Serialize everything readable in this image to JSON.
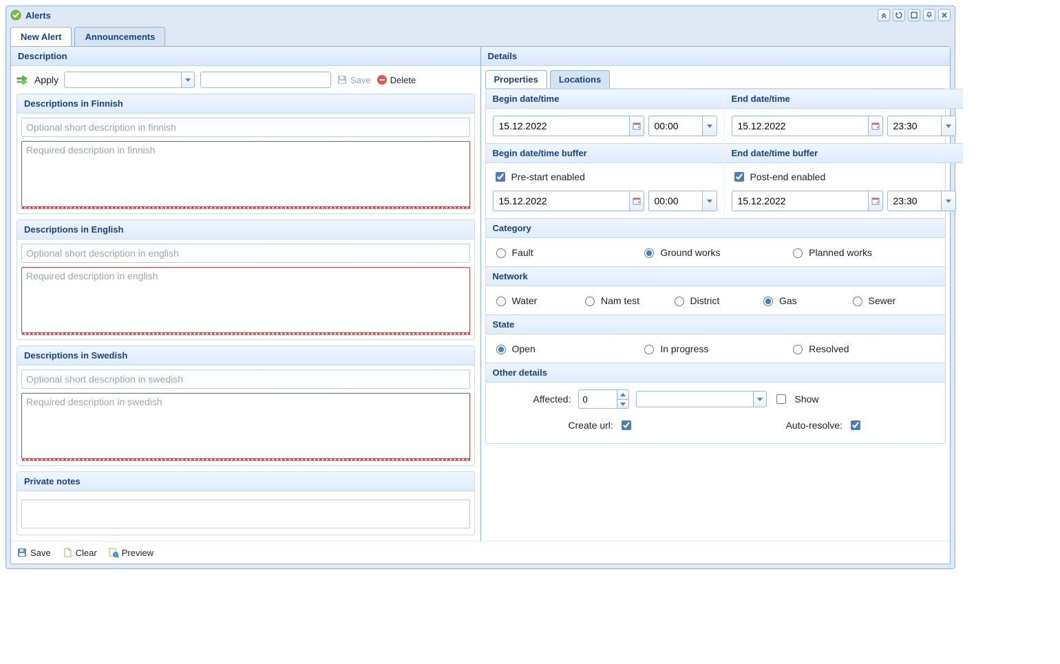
{
  "window": {
    "title": "Alerts"
  },
  "main_tabs": {
    "new_alert": "New Alert",
    "announcements": "Announcements"
  },
  "left": {
    "title": "Description",
    "apply_label": "Apply",
    "save_label": "Save",
    "delete_label": "Delete",
    "groups": {
      "fi": {
        "title": "Descriptions in Finnish",
        "short_ph": "Optional short description in finnish",
        "long_ph": "Required description in finnish"
      },
      "en": {
        "title": "Descriptions in English",
        "short_ph": "Optional short description in english",
        "long_ph": "Required description in english"
      },
      "sv": {
        "title": "Descriptions in Swedish",
        "short_ph": "Optional short description in swedish",
        "long_ph": "Required description in swedish"
      },
      "notes": {
        "title": "Private notes"
      }
    }
  },
  "right": {
    "title": "Details",
    "tabs": {
      "properties": "Properties",
      "locations": "Locations"
    },
    "begin": {
      "label": "Begin date/time",
      "date": "15.12.2022",
      "time": "00:00"
    },
    "end": {
      "label": "End date/time",
      "date": "15.12.2022",
      "time": "23:30"
    },
    "begin_buf": {
      "label": "Begin date/time buffer",
      "chk": "Pre-start enabled",
      "date": "15.12.2022",
      "time": "00:00"
    },
    "end_buf": {
      "label": "End date/time buffer",
      "chk": "Post-end enabled",
      "date": "15.12.2022",
      "time": "23:30"
    },
    "category": {
      "label": "Category",
      "fault": "Fault",
      "ground": "Ground works",
      "planned": "Planned works"
    },
    "network": {
      "label": "Network",
      "water": "Water",
      "nam": "Nam test",
      "district": "District",
      "gas": "Gas",
      "sewer": "Sewer"
    },
    "state": {
      "label": "State",
      "open": "Open",
      "progress": "In progress",
      "resolved": "Resolved"
    },
    "other": {
      "label": "Other details",
      "affected": "Affected:",
      "affected_val": "0",
      "show": "Show",
      "create_url": "Create url:",
      "auto_resolve": "Auto-resolve:"
    }
  },
  "footer": {
    "save": "Save",
    "clear": "Clear",
    "preview": "Preview"
  }
}
